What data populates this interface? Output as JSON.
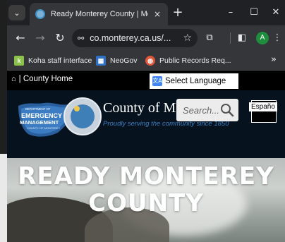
{
  "browser": {
    "tab": {
      "title": "Ready Monterey County | Mont",
      "close_icon": "×"
    },
    "new_tab_icon": "+",
    "window_controls": {
      "minimize": "–",
      "maximize": "☐",
      "close": "✕"
    },
    "toolbar": {
      "back": "←",
      "forward": "→",
      "reload": "↻",
      "url": "co.monterey.ca.us/...",
      "site_info_icon": "⚯",
      "star": "☆",
      "extensions": "⧉",
      "side_panel": "◧",
      "profile_initial": "A",
      "menu": "⋮"
    },
    "bookmarks": [
      {
        "label": "Koha staff interface",
        "icon": "k",
        "color": "#8bc34a"
      },
      {
        "label": "NeoGov",
        "icon": "▦",
        "color": "#2f6fc4"
      },
      {
        "label": "Public Records Req...",
        "icon": "◍",
        "color": "#e2553b"
      }
    ],
    "bookmarks_more": "»"
  },
  "page": {
    "home_icon": "⌂",
    "home_link": "| County Home",
    "language": {
      "icon": "文A",
      "label": "Select Language"
    },
    "header": {
      "county_title": "County of M",
      "tagline": "Proudly serving the community since 1850",
      "logo_text_top": "DEPARTMENT OF",
      "logo_text_main1": "EMERGENCY",
      "logo_text_main2": "MANAGEMENT",
      "logo_text_bottom": "COUNTY OF MONTEREY",
      "search_placeholder": "Search...",
      "espanol": "Españo"
    },
    "hero": {
      "line1": "READY MONTEREY",
      "line2": "COUNTY"
    }
  }
}
